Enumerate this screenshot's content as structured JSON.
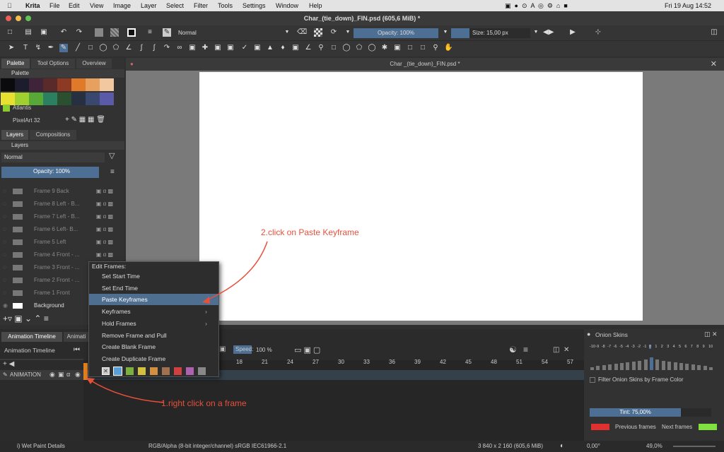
{
  "menubar": {
    "app": "Krita",
    "items": [
      "File",
      "Edit",
      "View",
      "Image",
      "Layer",
      "Select",
      "Filter",
      "Tools",
      "Settings",
      "Window",
      "Help"
    ],
    "clock": "Fri 19 Aug  14:52"
  },
  "window": {
    "title": "Char_(tie_down)_FIN.psd (605,6 MiB)  *",
    "doc_tab": "Char _(tie_down)_FIN.psd *"
  },
  "toolbar": {
    "blend_mode": "Normal",
    "opacity": "Opacity: 100%",
    "size": "Size: 15,00 px"
  },
  "docker": {
    "tabs": [
      "Palette",
      "Tool Options",
      "Overview"
    ],
    "palette_header": "Palette",
    "palette_colors": [
      "#0b0b0d",
      "#1c1c2c",
      "#3f2338",
      "#5a2a2a",
      "#8c3a24",
      "#e07a2a",
      "#e8a060",
      "#f2c8a0",
      "#e8e030",
      "#a0d030",
      "#58a838",
      "#2a8060",
      "#2a5030",
      "#263040",
      "#3a4870",
      "#5a5aa8"
    ],
    "palette_name": "Atlantis",
    "palette_file": "PixelArt 32",
    "layer_tabs": [
      "Layers",
      "Compositions"
    ],
    "layers_header": "Layers",
    "layers_blend": "Normal",
    "layers_opacity": "Opacity:  100%",
    "layers": [
      "Frame 9 Back",
      "Frame 8 Left - B...",
      "Frame 7 Left - B...",
      "Frame 6 Left- B...",
      "Frame 5 Left",
      "Frame 4 Front - ...",
      "Frame 3 Front - ...",
      "Frame 2 Front - ...",
      "Frame 1 Front",
      "Background"
    ]
  },
  "context_menu": {
    "title": "Edit Frames:",
    "items": [
      {
        "label": "Set Start Time",
        "submenu": false,
        "selected": false
      },
      {
        "label": "Set End Time",
        "submenu": false,
        "selected": false
      },
      {
        "label": "Paste Keyframes",
        "submenu": false,
        "selected": true
      },
      {
        "label": "Keyframes",
        "submenu": true,
        "selected": false
      },
      {
        "label": "Hold Frames",
        "submenu": true,
        "selected": false
      },
      {
        "label": "Remove Frame and Pull",
        "submenu": false,
        "selected": false
      },
      {
        "label": "Create Blank Frame",
        "submenu": false,
        "selected": false
      },
      {
        "label": "Create Duplicate Frame",
        "submenu": false,
        "selected": false
      }
    ],
    "color_labels": [
      "#cccccc",
      "#5a9ed8",
      "#7ab040",
      "#d4c040",
      "#d09040",
      "#a07050",
      "#d04040",
      "#b060b0",
      "#888888"
    ]
  },
  "animation": {
    "tabs": [
      "Animation Timeline",
      "Animati"
    ],
    "title": "Animation Timeline",
    "speed_label": "Speed:",
    "speed": "100 %",
    "layer_name": "ANIMATION",
    "frame_numbers": [
      "18",
      "21",
      "24",
      "27",
      "30",
      "33",
      "36",
      "39",
      "42",
      "45",
      "48",
      "51",
      "54",
      "57"
    ]
  },
  "onion": {
    "title": "Onion Skins",
    "numbers": [
      "-10",
      "-9",
      "-8",
      "-7",
      "-6",
      "-5",
      "-4",
      "-3",
      "-2",
      "-1",
      "0",
      "1",
      "2",
      "3",
      "4",
      "5",
      "6",
      "7",
      "8",
      "9",
      "10"
    ],
    "bar_levels": [
      0.2,
      0.25,
      0.3,
      0.35,
      0.4,
      0.45,
      0.5,
      0.55,
      0.6,
      0.7,
      0.8,
      0.7,
      0.6,
      0.55,
      0.5,
      0.45,
      0.4,
      0.35,
      0.3,
      0.25,
      0.2
    ],
    "filter_label": "Filter Onion Skins by Frame Color",
    "tint": "Tint: 75,00%",
    "previous": "Previous frames",
    "next": "Next frames",
    "prev_color": "#e03030",
    "next_color": "#80e040"
  },
  "status": {
    "tool": "i) Wet Paint Details",
    "color": "RGB/Alpha (8-bit integer/channel)  sRGB IEC61966-2.1",
    "dims": "3 840 x 2 160 (605,6 MiB)",
    "rotation": "0,00°",
    "zoom": "49,0%"
  },
  "annotations": {
    "step1": "1.right click on a frame",
    "step2": "2.click on Paste Keyframe"
  }
}
